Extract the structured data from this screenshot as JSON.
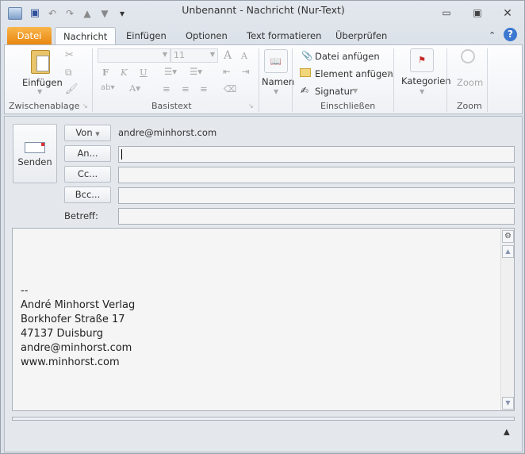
{
  "window": {
    "title": "Unbenannt  -  Nachricht (Nur-Text)"
  },
  "tabs": [
    "Datei",
    "Nachricht",
    "Einfügen",
    "Optionen",
    "Text formatieren",
    "Überprüfen"
  ],
  "ribbon": {
    "clipboard": {
      "paste": "Einfügen",
      "group": "Zwischenablage"
    },
    "basic_text": {
      "font_size": "11",
      "group": "Basistext",
      "bold": "F",
      "italic": "K",
      "underline": "U"
    },
    "names": {
      "label": "Namen"
    },
    "include": {
      "attach_file": "Datei anfügen",
      "attach_item": "Element anfügen",
      "signature": "Signatur",
      "group": "Einschließen"
    },
    "tags": {
      "categories": "Kategorien"
    },
    "zoom": {
      "label": "Zoom",
      "group": "Zoom"
    }
  },
  "compose": {
    "send": "Senden",
    "from_button": "Von",
    "from_value": "andre@minhorst.com",
    "to_button": "An...",
    "cc_button": "Cc...",
    "bcc_button": "Bcc...",
    "subject_label": "Betreff:",
    "to_value": "",
    "cc_value": "",
    "bcc_value": "",
    "subject_value": ""
  },
  "body": {
    "text": "--\nAndré Minhorst Verlag\nBorkhofer Straße 17\n47137 Duisburg\nandre@minhorst.com\nwww.minhorst.com"
  }
}
